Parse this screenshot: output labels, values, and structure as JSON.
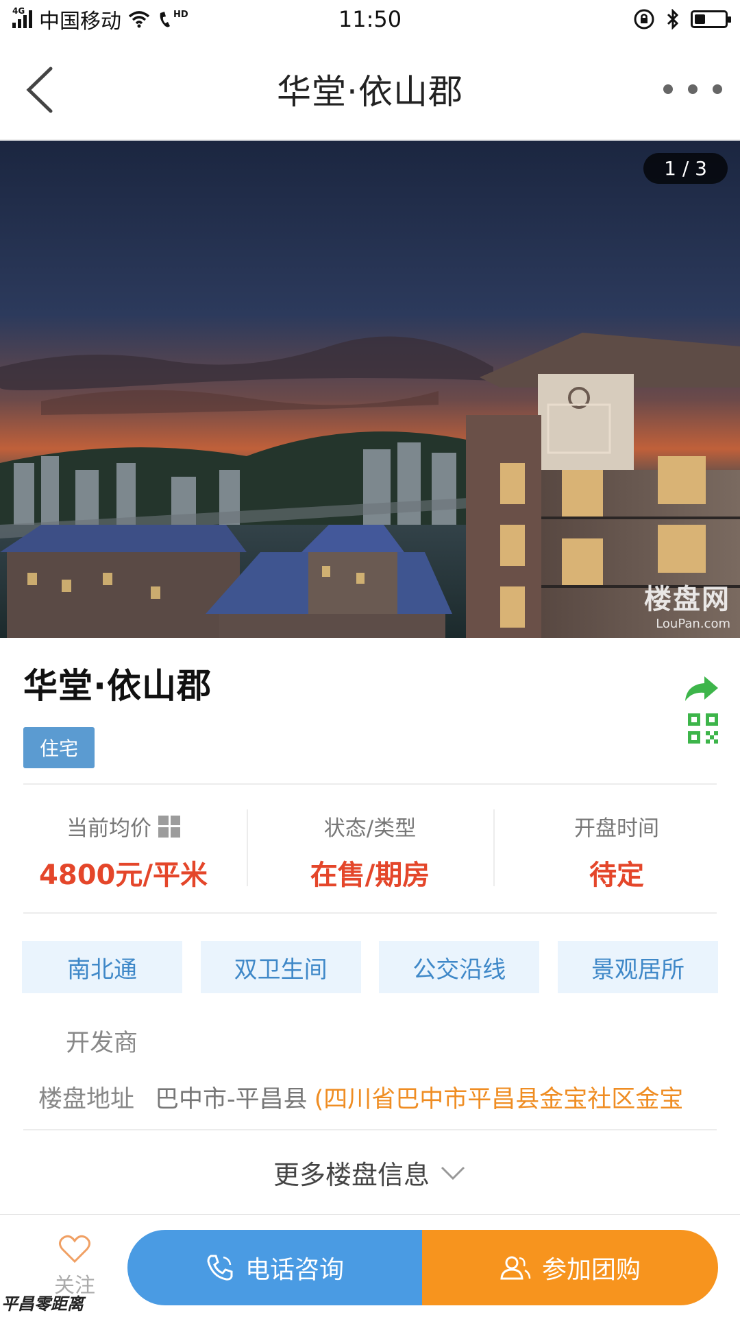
{
  "status_bar": {
    "network": "4G",
    "carrier": "中国移动",
    "hd": "HD",
    "time": "11:50",
    "battery_level": 0.35
  },
  "nav": {
    "title": "华堂·依山郡"
  },
  "gallery": {
    "indicator": "1 / 3",
    "watermark_cn": "楼盘网",
    "watermark_en": "LouPan.com"
  },
  "project": {
    "name": "华堂·依山郡",
    "type_tag": "住宅"
  },
  "stats": {
    "price_label": "当前均价",
    "price_value": "4800元/平米",
    "status_label": "状态/类型",
    "status_value": "在售/期房",
    "open_label": "开盘时间",
    "open_value": "待定"
  },
  "features": [
    "南北通",
    "双卫生间",
    "公交沿线",
    "景观居所"
  ],
  "details": {
    "developer_label": "开发商",
    "address_label": "楼盘地址",
    "address_area": "巴中市-平昌县",
    "address_detail": "(四川省巴中市平昌县金宝社区金宝"
  },
  "more_info": "更多楼盘信息",
  "bottom_bar": {
    "follow_label": "关注",
    "call_label": "电话咨询",
    "group_label": "参加团购"
  },
  "corner_watermark": "平昌零距离",
  "colors": {
    "price_red": "#e4462a",
    "tag_blue": "#5b9bd1",
    "call_blue": "#4a9be3",
    "group_orange": "#f7941e",
    "share_green": "#3db54a"
  }
}
